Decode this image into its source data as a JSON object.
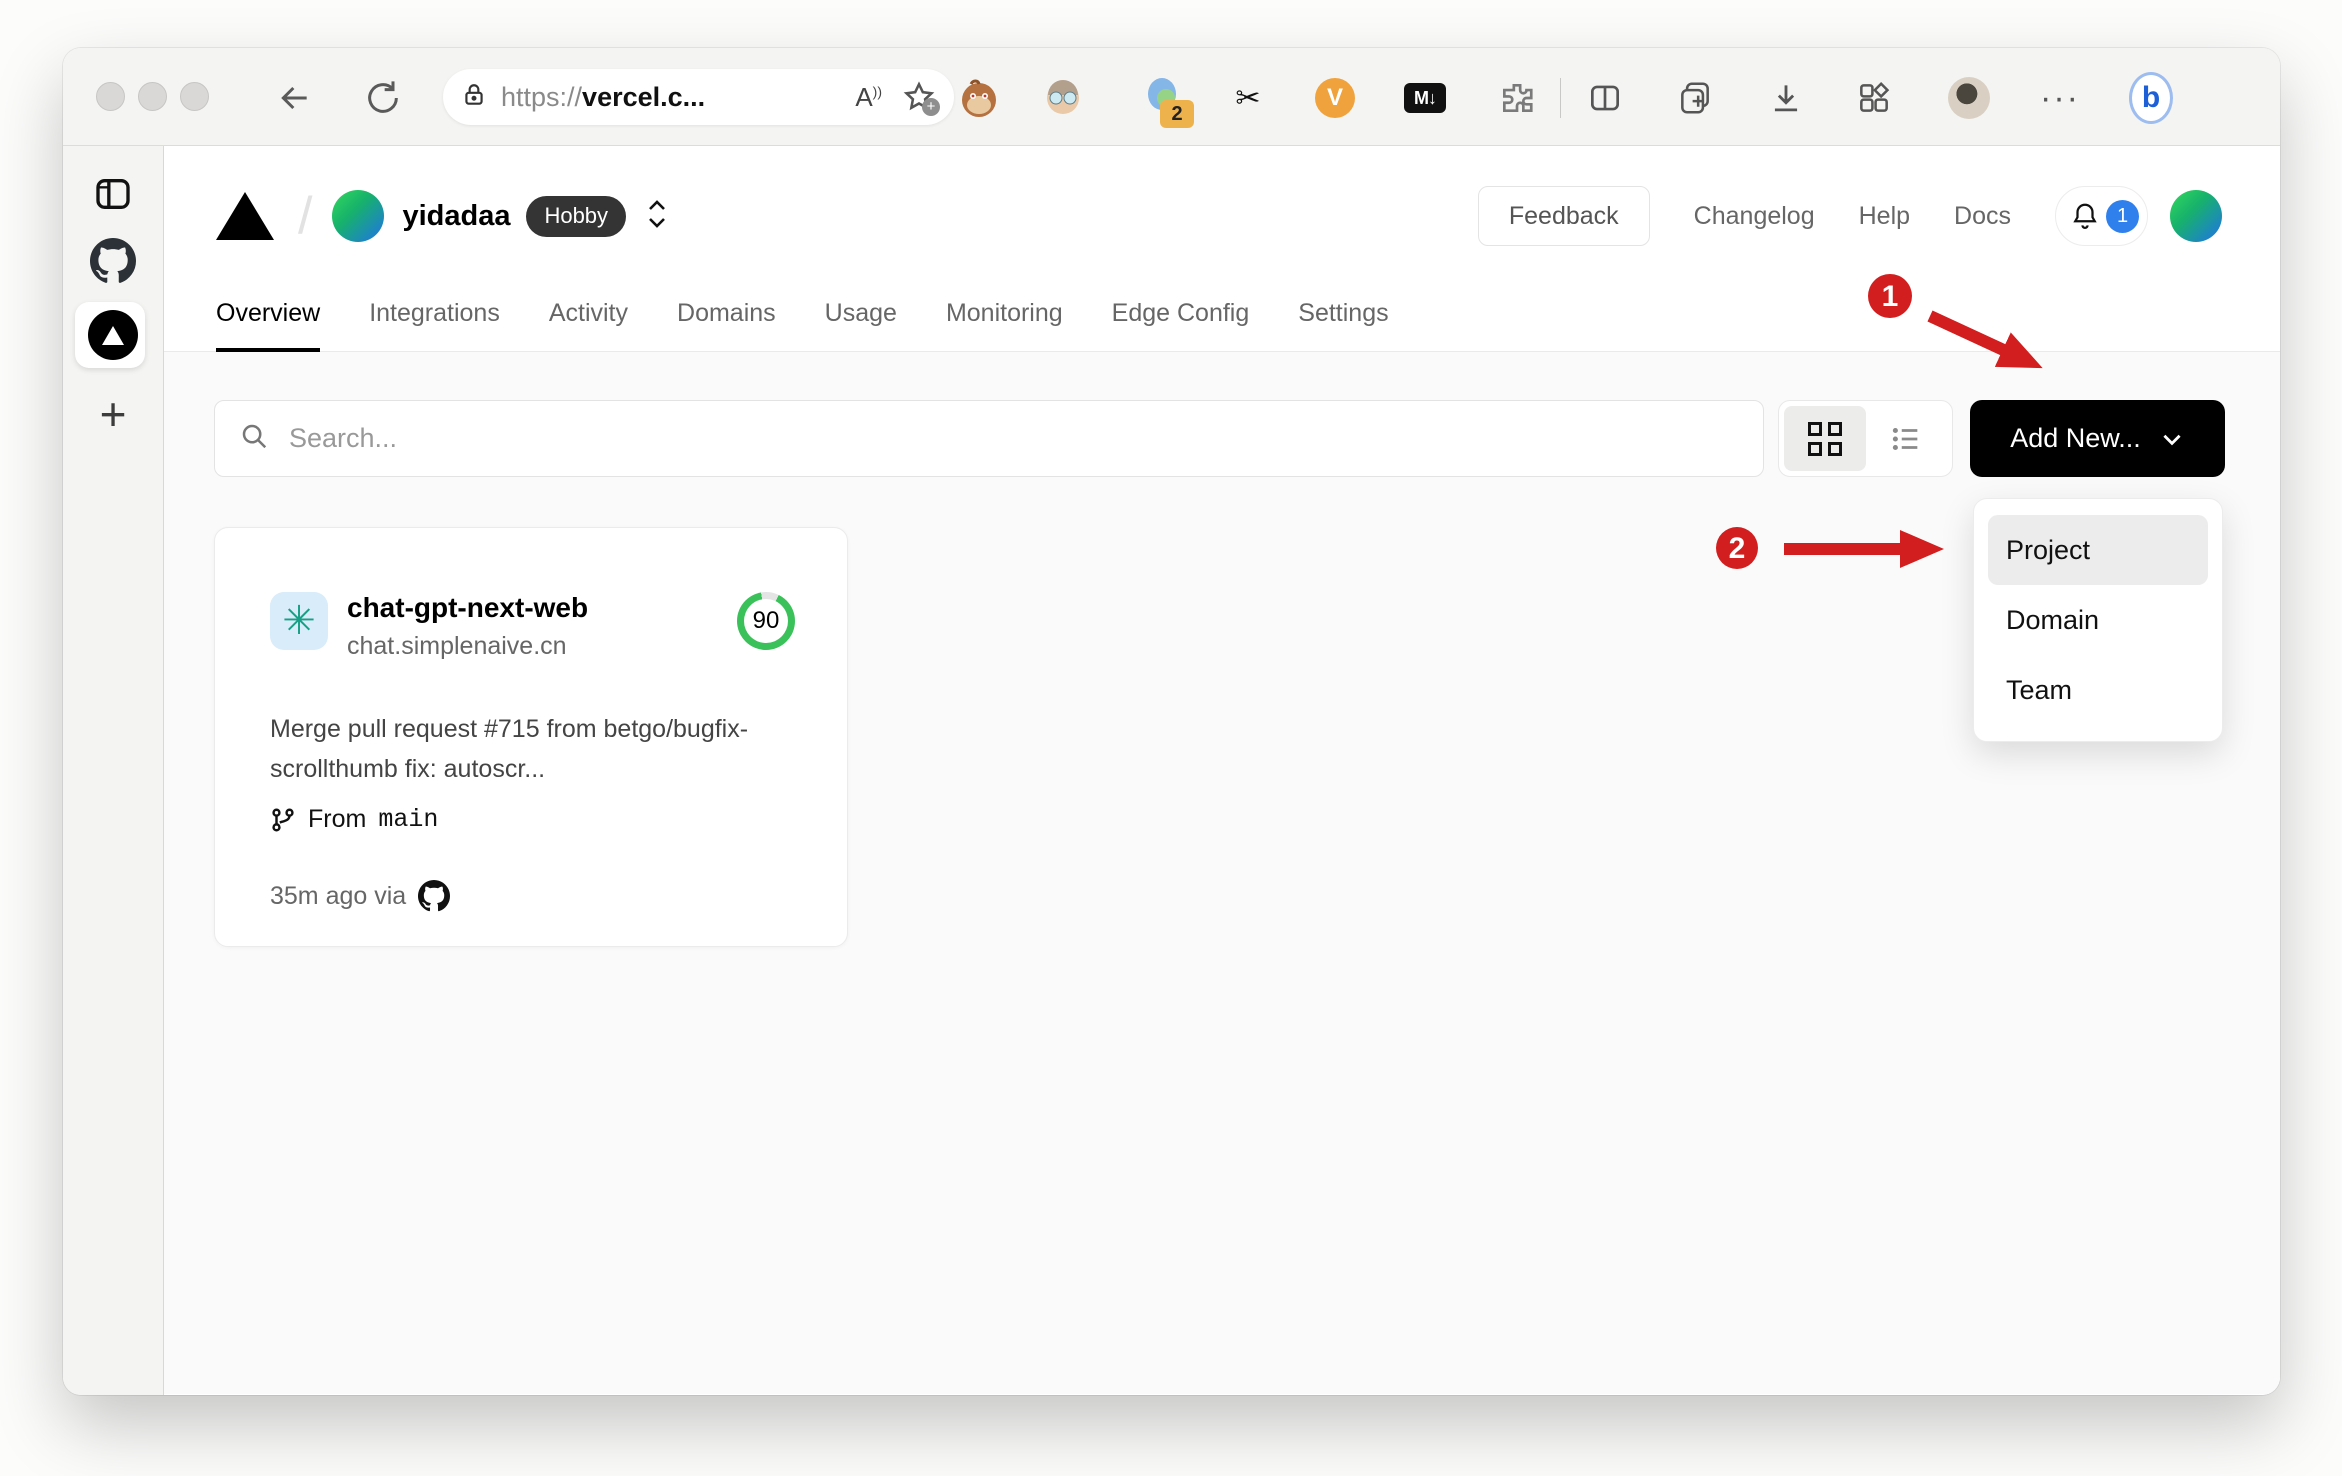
{
  "colors": {
    "annotation_red": "#d21e1e",
    "score_green": "#3bc15a",
    "notification_blue": "#2f80ed",
    "add_new_black": "#000000",
    "hobby_badge_bg": "#343434"
  },
  "browser": {
    "url_prefix": "https://",
    "url_host": "vercel.c...",
    "reader_label": "A",
    "more_label": "···",
    "extensions": {
      "profile_badge_count": "2",
      "vimium_label": "V",
      "markdown_label": "M↓",
      "scissors_glyph": "✂",
      "bing_label": "b"
    }
  },
  "vercel": {
    "breadcrumb": {
      "separator": "/",
      "team_name": "yidadaa",
      "plan_badge": "Hobby"
    },
    "header_nav": {
      "feedback": "Feedback",
      "changelog": "Changelog",
      "help": "Help",
      "docs": "Docs",
      "notification_count": "1"
    },
    "tabs": [
      {
        "label": "Overview",
        "active": true
      },
      {
        "label": "Integrations",
        "active": false
      },
      {
        "label": "Activity",
        "active": false
      },
      {
        "label": "Domains",
        "active": false
      },
      {
        "label": "Usage",
        "active": false
      },
      {
        "label": "Monitoring",
        "active": false
      },
      {
        "label": "Edge Config",
        "active": false
      },
      {
        "label": "Settings",
        "active": false
      }
    ],
    "toolbar": {
      "search_placeholder": "Search...",
      "add_new_label": "Add New..."
    },
    "add_new_menu": {
      "items": [
        {
          "label": "Project",
          "highlighted": true
        },
        {
          "label": "Domain",
          "highlighted": false
        },
        {
          "label": "Team",
          "highlighted": false
        }
      ]
    },
    "project_card": {
      "name": "chat-gpt-next-web",
      "domain": "chat.simplenaive.cn",
      "score": "90",
      "commit_message": "Merge pull request #715 from betgo/bugfix-scrollthumb fix: autoscr...",
      "branch_prefix": "From",
      "branch_name": "main",
      "deployed_info": "35m ago via"
    }
  },
  "annotations": {
    "step1": "1",
    "step2": "2"
  }
}
